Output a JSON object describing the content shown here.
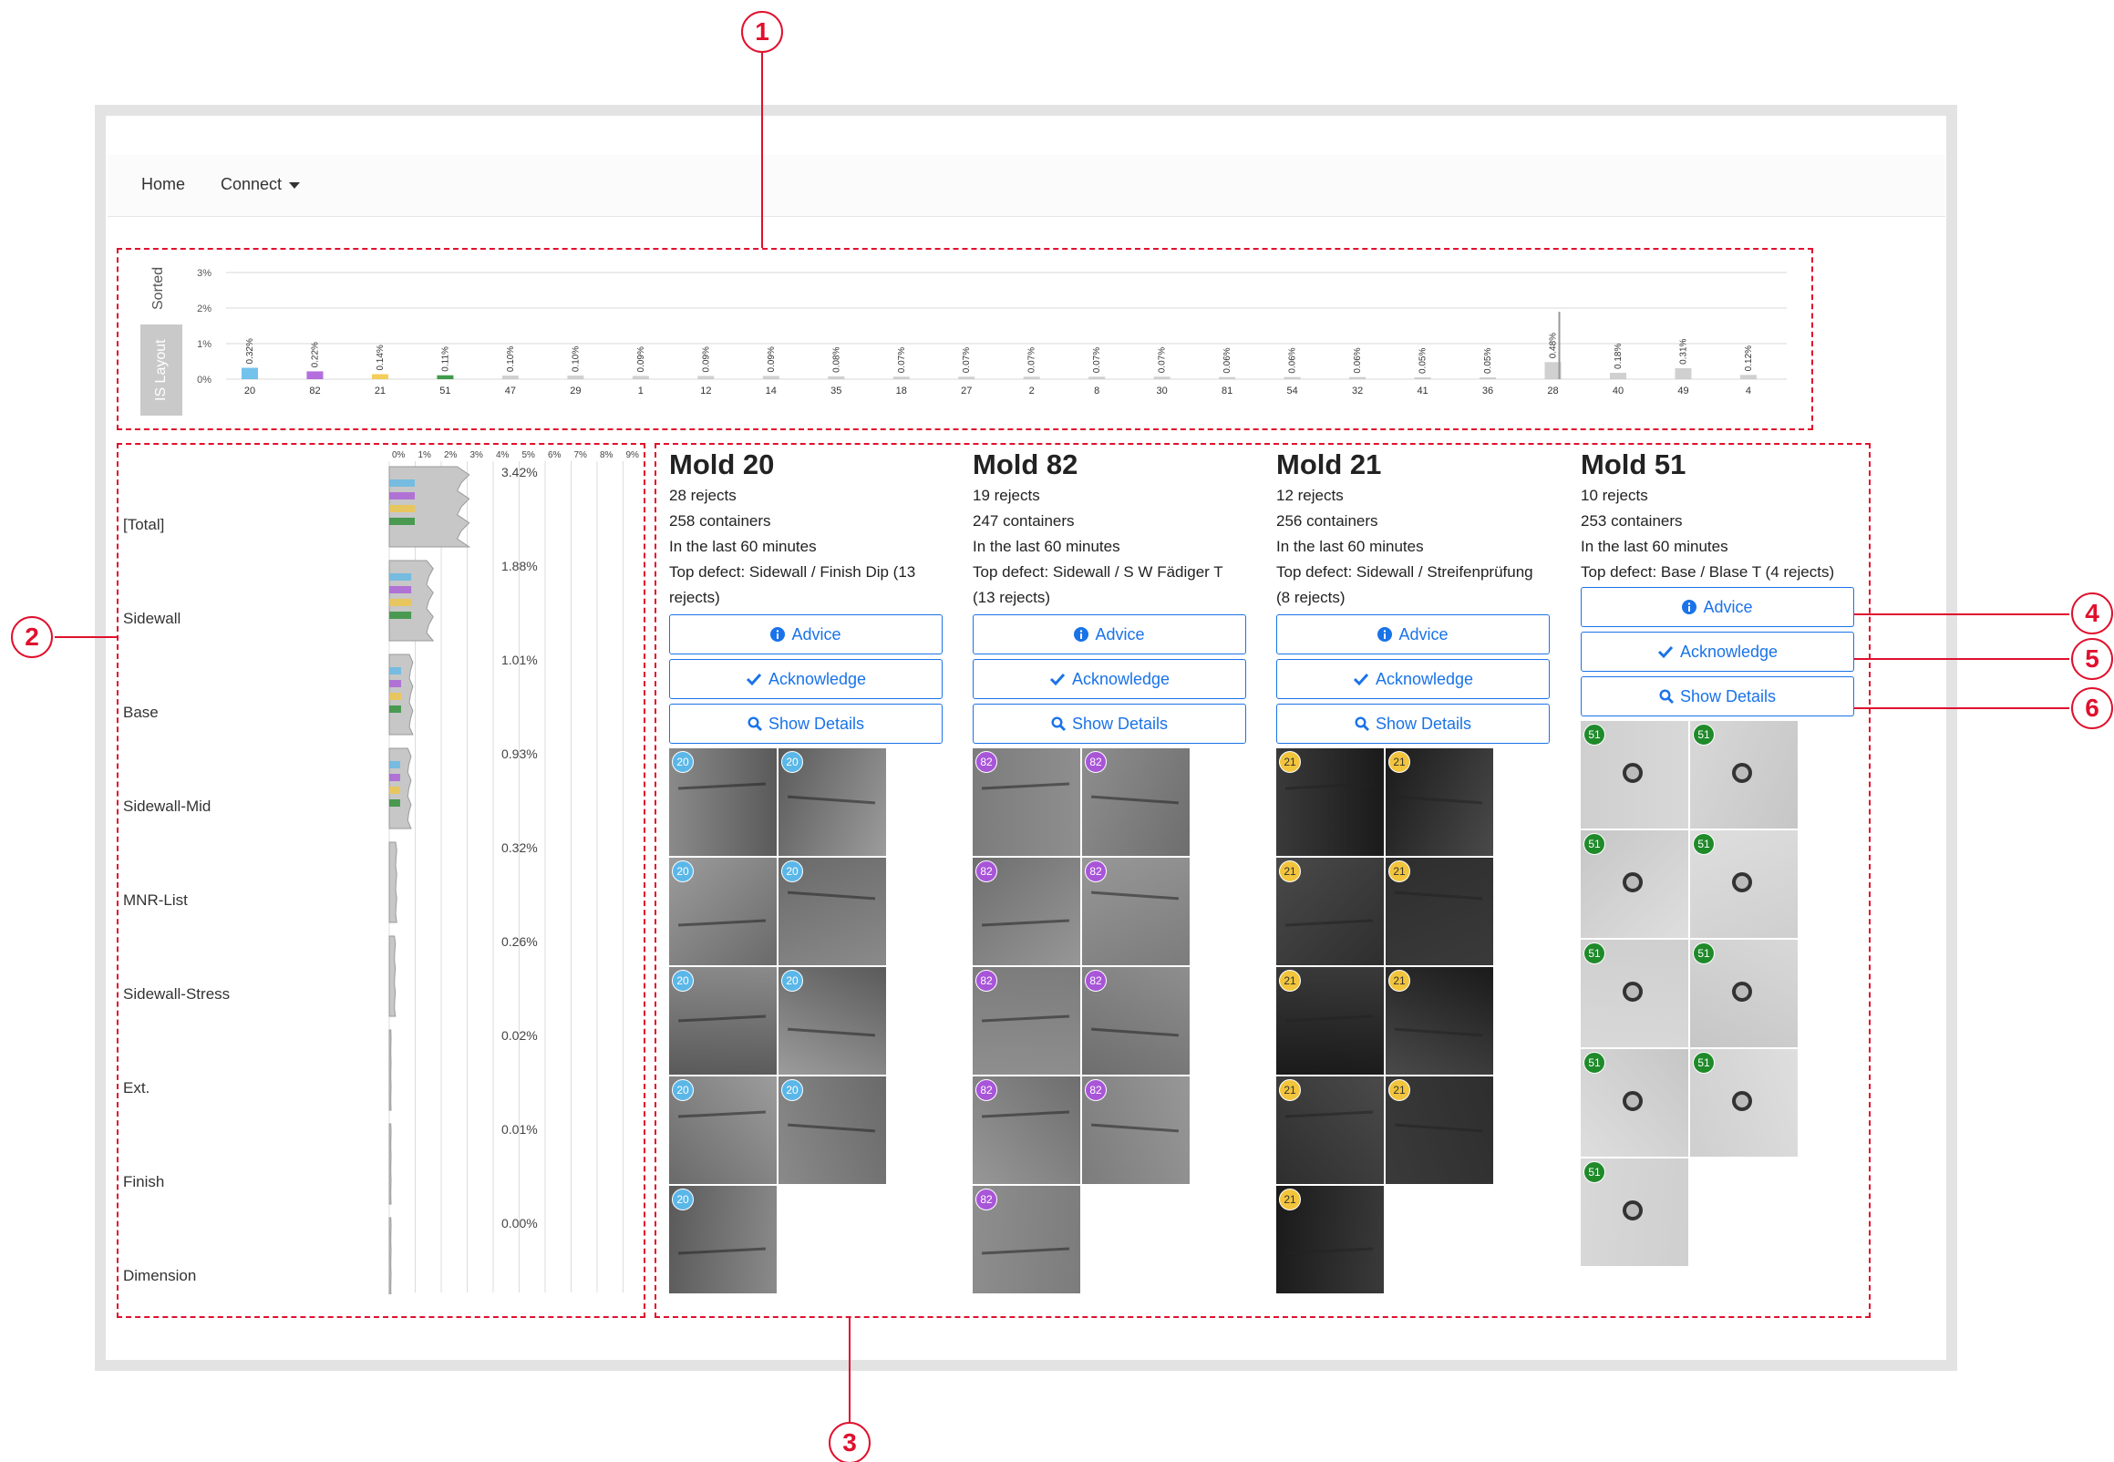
{
  "nav": {
    "home": "Home",
    "connect": "Connect"
  },
  "callouts": [
    "1",
    "2",
    "3",
    "4",
    "5",
    "6"
  ],
  "top_chart": {
    "sorted_label": "Sorted",
    "layout_label": "IS Layout",
    "y_ticks": [
      "3%",
      "2%",
      "1%",
      "0%"
    ],
    "highlight_color": "#c4c4c4"
  },
  "chart_data": {
    "type": "bar",
    "categories": [
      "20",
      "82",
      "21",
      "51",
      "47",
      "29",
      "1",
      "12",
      "14",
      "35",
      "18",
      "27",
      "2",
      "8",
      "30",
      "81",
      "54",
      "32",
      "41",
      "36",
      "28",
      "40",
      "49",
      "4"
    ],
    "values": [
      0.32,
      0.22,
      0.14,
      0.11,
      0.1,
      0.1,
      0.09,
      0.09,
      0.09,
      0.08,
      0.07,
      0.07,
      0.07,
      0.07,
      0.07,
      0.06,
      0.06,
      0.06,
      0.05,
      0.05,
      0.48,
      0.18,
      0.31,
      0.12
    ],
    "data_labels": [
      "0.32%",
      "0.22%",
      "0.14%",
      "0.11%",
      "0.10%",
      "0.10%",
      "0.09%",
      "0.09%",
      "0.09%",
      "0.08%",
      "0.07%",
      "0.07%",
      "0.07%",
      "0.07%",
      "0.07%",
      "0.06%",
      "0.06%",
      "0.06%",
      "0.05%",
      "0.05%",
      "0.48%",
      "0.18%",
      "0.31%",
      "0.12%"
    ],
    "colors": [
      "#5bb7e8",
      "#a855d8",
      "#f2c53d",
      "#1f8a2a",
      "#c8c8c8",
      "#c8c8c8",
      "#c8c8c8",
      "#c8c8c8",
      "#c8c8c8",
      "#c8c8c8",
      "#c8c8c8",
      "#c8c8c8",
      "#c8c8c8",
      "#c8c8c8",
      "#c8c8c8",
      "#c8c8c8",
      "#c8c8c8",
      "#c8c8c8",
      "#c8c8c8",
      "#c8c8c8",
      "#c8c8c8",
      "#c8c8c8",
      "#c8c8c8",
      "#c8c8c8"
    ],
    "ylim": [
      0,
      3
    ],
    "grid": true
  },
  "defects": {
    "axis_ticks": [
      "0%",
      "1%",
      "2%",
      "3%",
      "4%",
      "5%",
      "6%",
      "7%",
      "8%",
      "9%"
    ],
    "rows": [
      {
        "name": "[Total]",
        "pct": "3.42%",
        "value": 3.42
      },
      {
        "name": "Sidewall",
        "pct": "1.88%",
        "value": 1.88
      },
      {
        "name": "Base",
        "pct": "1.01%",
        "value": 1.01
      },
      {
        "name": "Sidewall-Mid",
        "pct": "0.93%",
        "value": 0.93
      },
      {
        "name": "MNR-List",
        "pct": "0.32%",
        "value": 0.32
      },
      {
        "name": "Sidewall-Stress",
        "pct": "0.26%",
        "value": 0.26
      },
      {
        "name": "Ext.",
        "pct": "0.02%",
        "value": 0.02
      },
      {
        "name": "Finish",
        "pct": "0.01%",
        "value": 0.01
      },
      {
        "name": "Dimension",
        "pct": "0.00%",
        "value": 0.0
      }
    ]
  },
  "buttons": {
    "advice": "Advice",
    "acknowledge": "Acknowledge",
    "details": "Show Details"
  },
  "molds": [
    {
      "title": "Mold 20",
      "rejects": "28 rejects",
      "containers": "258 containers",
      "period": "In the last 60 minutes",
      "top_defect": "Top defect: Sidewall / Finish Dip (13 rejects)",
      "badge": "20",
      "badge_color": "#5bb7e8",
      "image_count": 9
    },
    {
      "title": "Mold 82",
      "rejects": "19 rejects",
      "containers": "247 containers",
      "period": "In the last 60 minutes",
      "top_defect": "Top defect: Sidewall / S W Fädiger T (13 rejects)",
      "badge": "82",
      "badge_color": "#a855d8",
      "image_count": 9
    },
    {
      "title": "Mold 21",
      "rejects": "12 rejects",
      "containers": "256 containers",
      "period": "In the last 60 minutes",
      "top_defect": "Top defect: Sidewall / Streifenprüfung (8 rejects)",
      "badge": "21",
      "badge_color": "#f2c53d",
      "image_count": 9
    },
    {
      "title": "Mold 51",
      "rejects": "10 rejects",
      "containers": "253 containers",
      "period": "In the last 60 minutes",
      "top_defect": "Top defect: Base / Blase T (4 rejects)",
      "badge": "51",
      "badge_color": "#1f8a2a",
      "image_count": 9
    }
  ]
}
